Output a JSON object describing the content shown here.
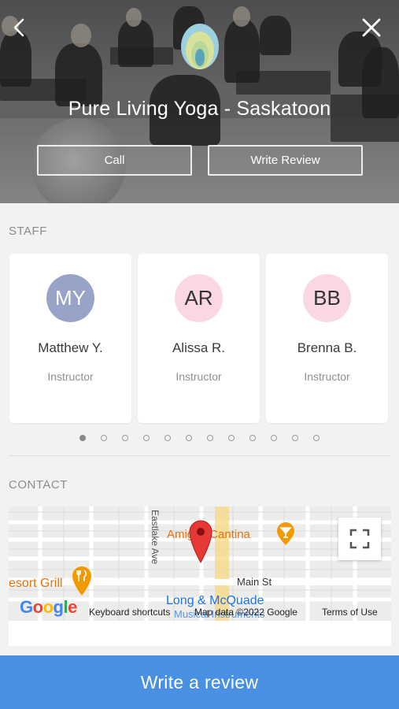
{
  "header": {
    "title": "Pure Living Yoga - Saskatoon",
    "back_icon": "chevron-left-icon",
    "close_icon": "close-icon",
    "call_label": "Call",
    "write_review_label": "Write Review"
  },
  "staff": {
    "section_label": "STAFF",
    "members": [
      {
        "initials": "MY",
        "name": "Matthew Y.",
        "role": "Instructor",
        "avatar_bg": "#97a3c7",
        "avatar_fg": "#ffffff"
      },
      {
        "initials": "AR",
        "name": "Alissa R.",
        "role": "Instructor",
        "avatar_bg": "#fbd7e2",
        "avatar_fg": "#333333"
      },
      {
        "initials": "BB",
        "name": "Brenna B.",
        "role": "Instructor",
        "avatar_bg": "#fbd7e2",
        "avatar_fg": "#333333"
      }
    ],
    "page_dots": 12,
    "active_dot": 0
  },
  "contact": {
    "section_label": "CONTACT",
    "map": {
      "labels": {
        "cantina": "Amigos Cantina",
        "street_vertical": "Eastlake Ave",
        "street_main": "Main St",
        "resort": "esort Grill",
        "long": "Long & McQuade",
        "musical": "Musical Instruments"
      },
      "logo": "Google",
      "keyboard_shortcuts": "Keyboard shortcuts",
      "map_data": "Map data ©2022 Google",
      "terms": "Terms of Use",
      "pin_icon": "map-pin-icon",
      "fullscreen_icon": "fullscreen-icon"
    }
  },
  "cta": {
    "label": "Write a review"
  },
  "colors": {
    "accent": "#4a90e2",
    "pin": "#e53935",
    "poi_orange": "#f29900",
    "poi_blue": "#1a73e8"
  }
}
